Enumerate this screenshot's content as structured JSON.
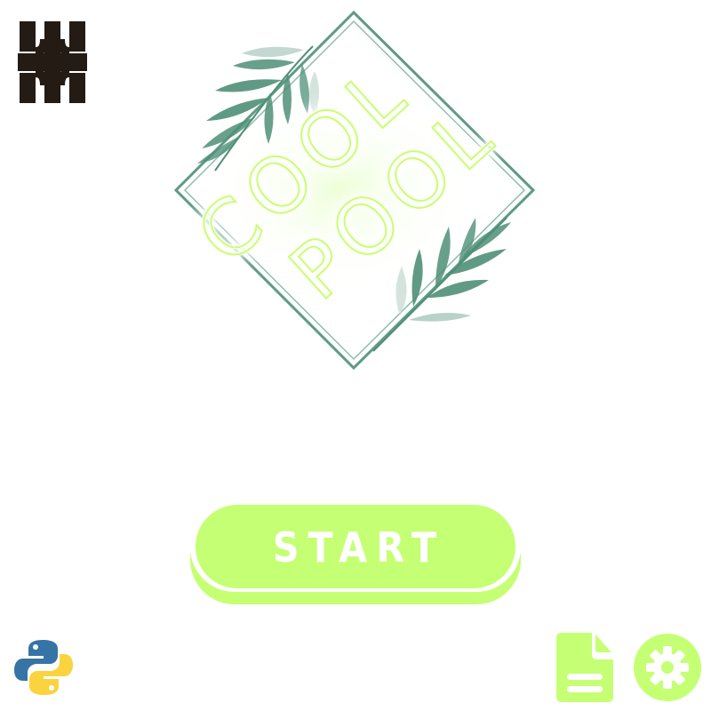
{
  "title_art": {
    "line1": "COOL",
    "line2": "POOL"
  },
  "start_button": {
    "label": "START"
  },
  "icons": {
    "top_left_logo": "utn-logo",
    "bottom_left_logo": "python-logo",
    "document": "document-icon",
    "settings": "gear-icon"
  },
  "colors": {
    "accent": "#c5ff73",
    "accent_dark": "#b5f55f",
    "neon_glow": "#c6ff6a",
    "leaf": "#4f8f78",
    "frame": "#5f9a85",
    "utn": "#231b14",
    "python_blue": "#3774a6",
    "python_yellow": "#f9d43f"
  }
}
